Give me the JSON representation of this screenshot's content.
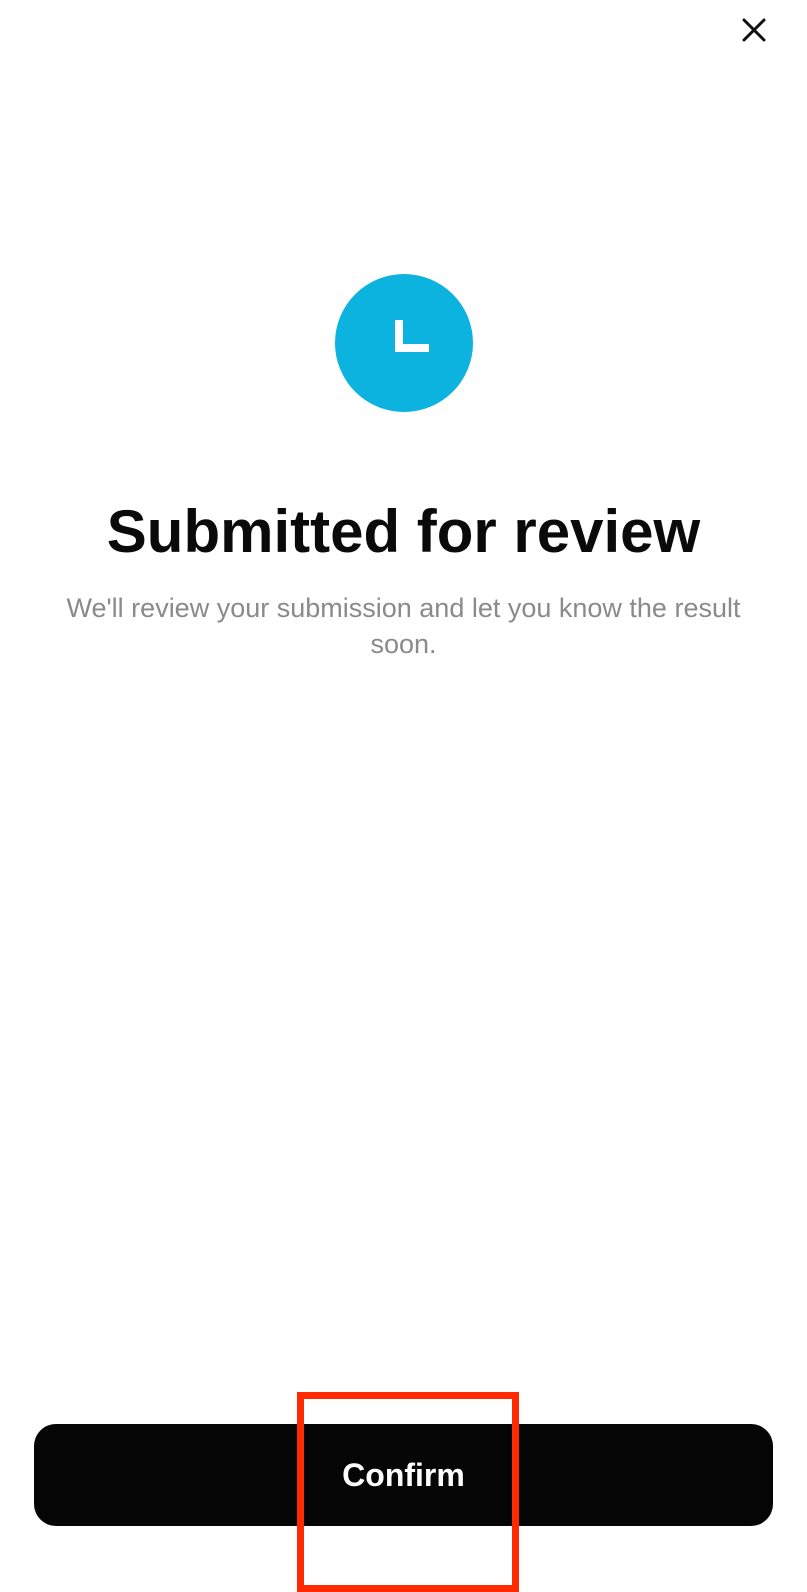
{
  "header": {
    "close_icon": "close-icon"
  },
  "status": {
    "icon": "clock-icon",
    "title": "Submitted for review",
    "message": "We'll review your submission and let you know the result soon."
  },
  "footer": {
    "confirm_label": "Confirm"
  },
  "colors": {
    "accent": "#0bb3de",
    "button_bg": "#050505",
    "button_text": "#ffffff",
    "highlight": "#ff2a00",
    "title": "#0a0a0a",
    "subtitle": "#8a8a8a"
  }
}
